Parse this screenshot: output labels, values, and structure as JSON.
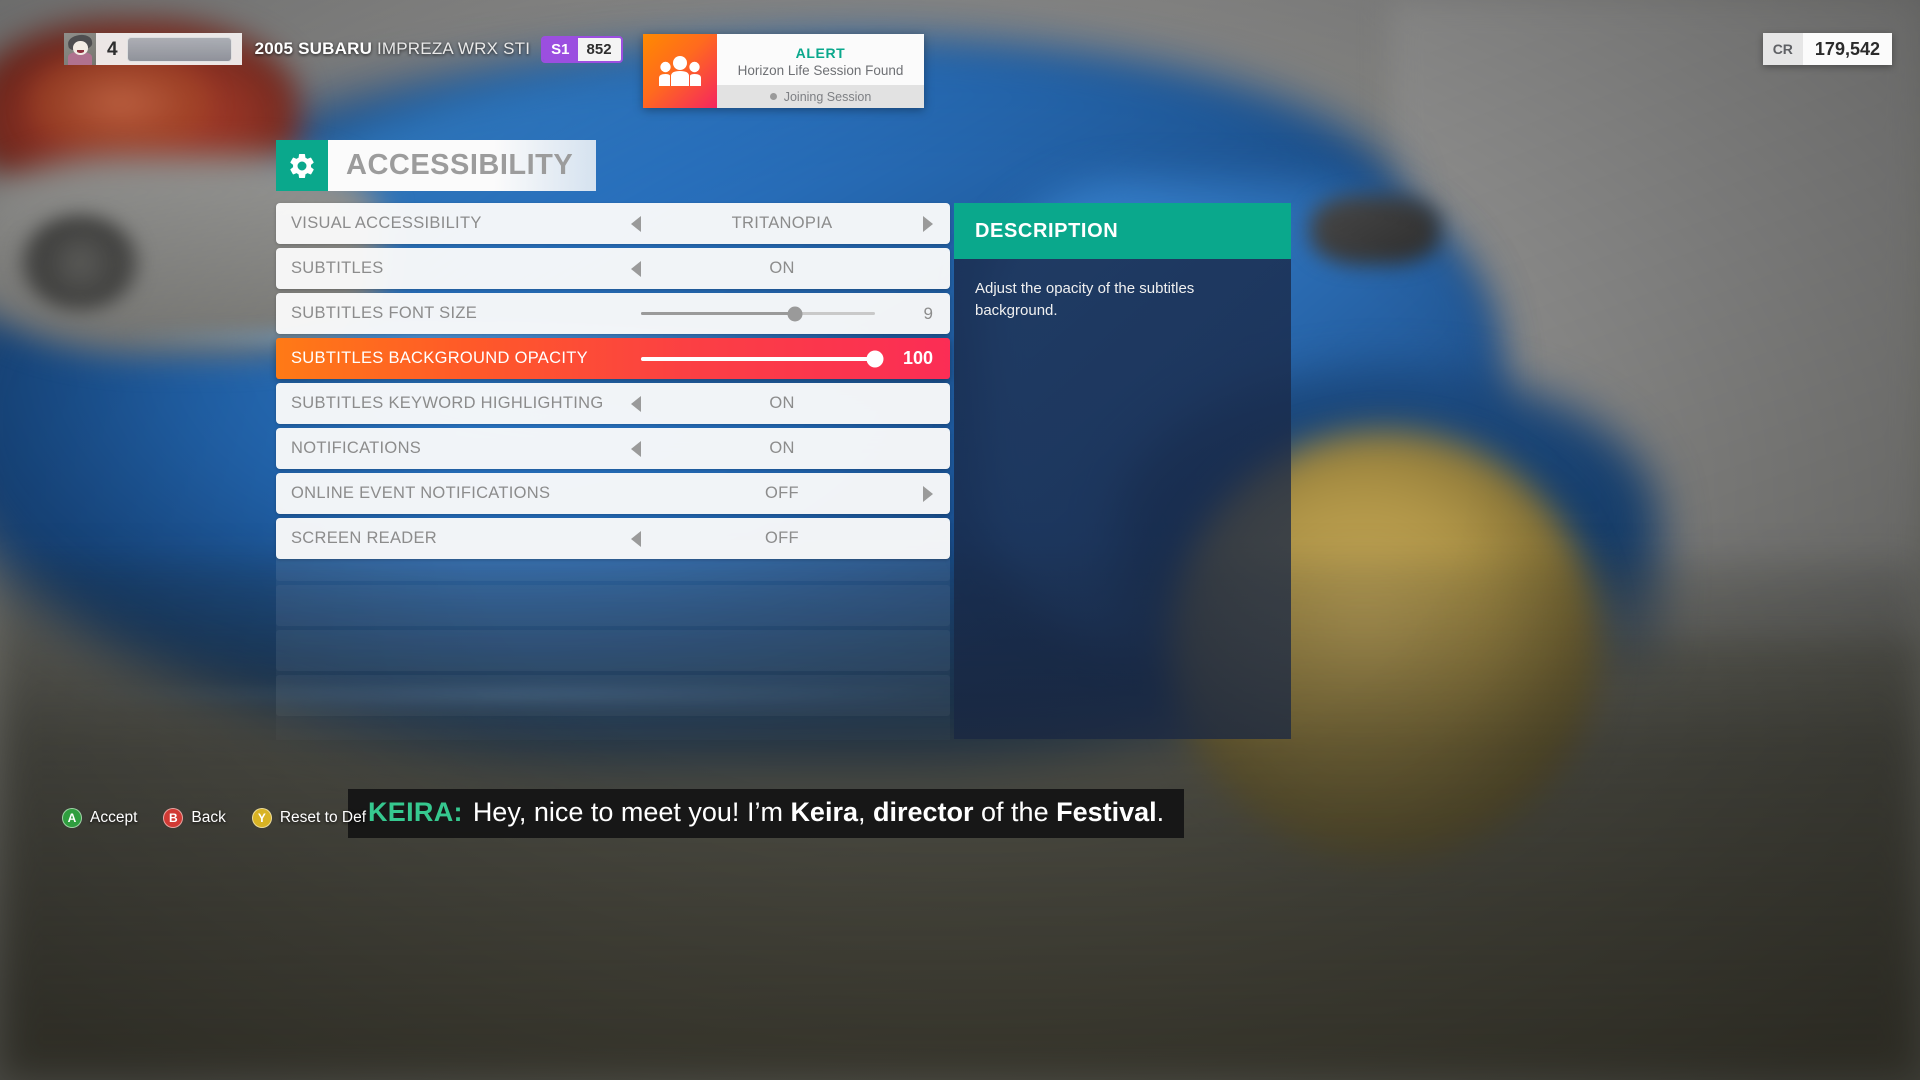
{
  "hud": {
    "player": {
      "level": "4",
      "avatar_icon": "player-avatar",
      "xp_bar_label": ""
    },
    "car": {
      "year_make": "2005 SUBARU",
      "model": "IMPREZA WRX STI",
      "pi_class": "S1",
      "pi_value": "852"
    },
    "credits": {
      "label": "CR",
      "value": "179,542"
    }
  },
  "alert": {
    "icon": "people-group-icon",
    "title": "ALERT",
    "subtitle": "Horizon Life Session Found",
    "status": "Joining Session",
    "title_color": "#0aa88c",
    "icon_gradient_from": "#ff8a00",
    "icon_gradient_to": "#f5255f"
  },
  "menu": {
    "icon": "gear-icon",
    "title": "ACCESSIBILITY",
    "accent_color": "#0aa88c",
    "selected_index": 3,
    "rows": [
      {
        "label": "VISUAL ACCESSIBILITY",
        "type": "option",
        "value": "TRITANOPIA",
        "left_arrow": true,
        "right_arrow": true
      },
      {
        "label": "SUBTITLES",
        "type": "option",
        "value": "ON",
        "left_arrow": true,
        "right_arrow": false
      },
      {
        "label": "SUBTITLES FONT SIZE",
        "type": "slider",
        "value": "9",
        "percent": 66
      },
      {
        "label": "SUBTITLES BACKGROUND OPACITY",
        "type": "slider",
        "value": "100",
        "percent": 100
      },
      {
        "label": "SUBTITLES KEYWORD HIGHLIGHTING",
        "type": "option",
        "value": "ON",
        "left_arrow": true,
        "right_arrow": false
      },
      {
        "label": "NOTIFICATIONS",
        "type": "option",
        "value": "ON",
        "left_arrow": true,
        "right_arrow": false
      },
      {
        "label": "ONLINE EVENT NOTIFICATIONS",
        "type": "option",
        "value": "OFF",
        "left_arrow": false,
        "right_arrow": true
      },
      {
        "label": "SCREEN READER",
        "type": "option",
        "value": "OFF",
        "left_arrow": true,
        "right_arrow": false
      }
    ]
  },
  "description": {
    "header": "DESCRIPTION",
    "text": "Adjust the opacity of the subtitles background."
  },
  "subtitle": {
    "speaker": "KEIRA:",
    "text_before": "Hey, nice to meet you! I’m ",
    "keyword1": "Keira",
    "text_mid1": ", ",
    "keyword2": "director",
    "text_mid2": " of the ",
    "keyword3": "Festival",
    "text_after": ".",
    "speaker_color": "#36c88f"
  },
  "prompts": [
    {
      "button": "A",
      "label": "Accept",
      "color": "#2f9e3f"
    },
    {
      "button": "B",
      "label": "Back",
      "color": "#d13a34"
    },
    {
      "button": "Y",
      "label": "Reset to Def",
      "color": "#d8b324"
    }
  ]
}
